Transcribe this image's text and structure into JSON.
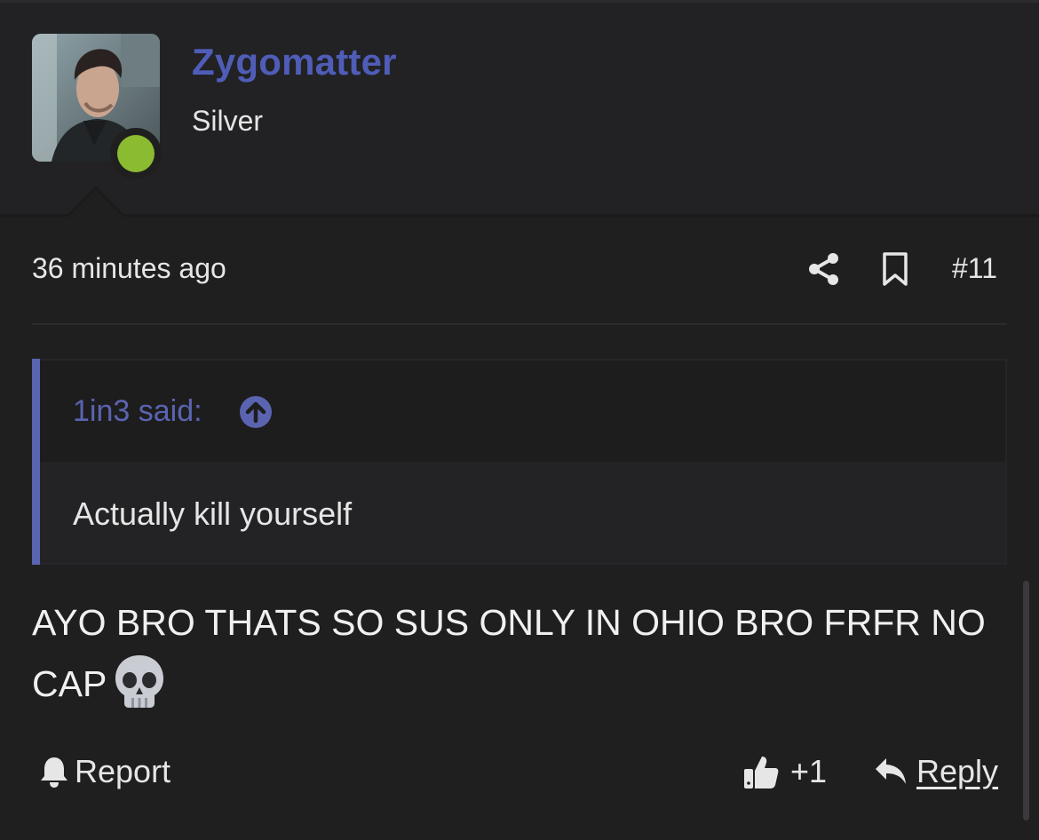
{
  "user": {
    "name": "Zygomatter",
    "title": "Silver",
    "online": true
  },
  "post": {
    "time": "36 minutes ago",
    "number": "#11",
    "message": "AYO BRO THATS SO SUS ONLY IN OHIO BRO FRFR NO CAP",
    "emoji": "skull-icon"
  },
  "quote": {
    "attribution": "1in3 said:",
    "text": "Actually kill yourself"
  },
  "actions": {
    "report_label": "Report",
    "like_count": "+1",
    "reply_label": "Reply"
  },
  "colors": {
    "accent": "#4f5db8",
    "quote_accent": "#5a64b0",
    "online": "#8bbb30",
    "background": "#1f1f20"
  }
}
